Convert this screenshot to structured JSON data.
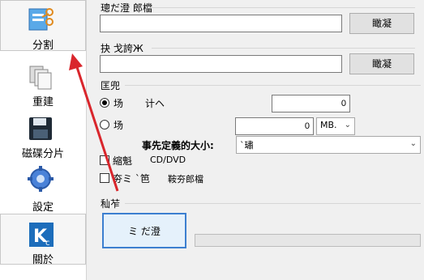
{
  "sidebar": {
    "items": [
      {
        "label": "分割",
        "icon": "split-file-icon"
      },
      {
        "label": "重建",
        "icon": "rebuild-pages-icon"
      },
      {
        "label": "磁碟分片",
        "icon": "floppy-disk-icon"
      },
      {
        "label": "設定",
        "icon": "gear-icon"
      },
      {
        "label": "關於",
        "icon": "k-logo-icon"
      }
    ]
  },
  "form": {
    "source_group_label": "璁だ澄 郎檔",
    "source_value": "",
    "source_browse": "瞰凝",
    "dest_group_label": "抉 戈誇Ж",
    "dest_value": "",
    "dest_browse": "瞰凝",
    "options_group_label": "匡兜",
    "option1_label": "场",
    "option1_suffix": "计ヘ",
    "option1_value": "0",
    "option2_label": "场",
    "option2_value": "0",
    "option2_unit": "MB.",
    "preset_label": "事先定義的大小:",
    "preset_value": "`璛",
    "check1_label": "縮魁",
    "check1_suffix": "CD/DVD",
    "check2_label": "夯ミ `笆",
    "check2_suffix": "鞍夯郎檔",
    "action_group_label": "秈苲",
    "split_button": "ミ だ澄"
  },
  "colors": {
    "accent_border": "#3c7fd0",
    "arrow": "#d9262c"
  }
}
